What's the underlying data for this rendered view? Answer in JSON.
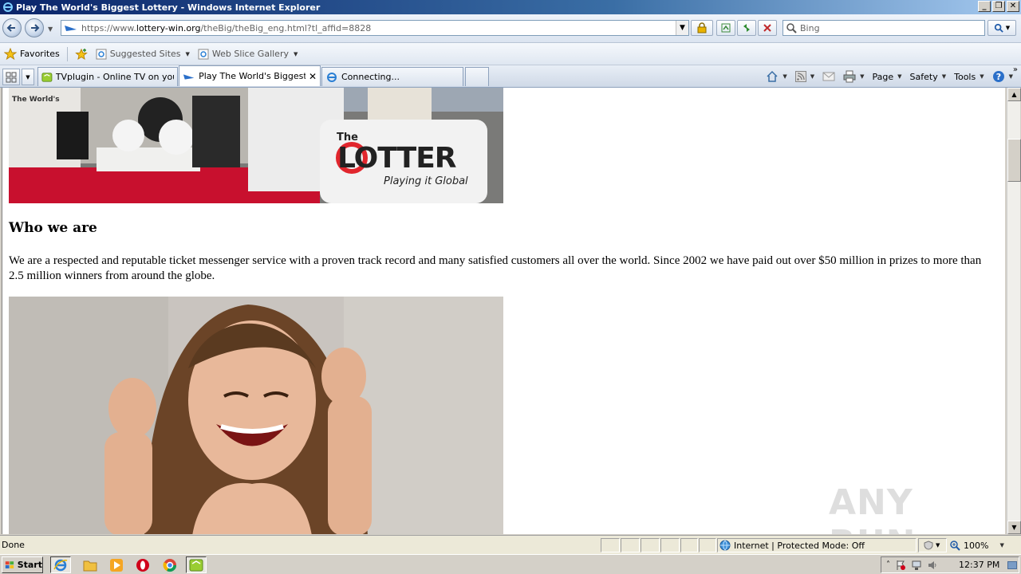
{
  "window": {
    "title": "Play The World's Biggest Lottery - Windows Internet Explorer"
  },
  "address": {
    "url_prefix": "https://www.",
    "url_domain": "lottery-win.org",
    "url_path": "/theBig/theBig_eng.html?tl_affid=8828"
  },
  "search": {
    "placeholder": "Bing"
  },
  "favorites_bar": {
    "favorites_label": "Favorites",
    "suggested_sites_label": "Suggested Sites",
    "web_slice_label": "Web Slice Gallery"
  },
  "tabs": [
    {
      "label": "TVplugin - Online TV on your ..."
    },
    {
      "label": "Play The World's Biggest ..."
    },
    {
      "label": "Connecting..."
    }
  ],
  "command_bar": {
    "page_label": "Page",
    "safety_label": "Safety",
    "tools_label": "Tools"
  },
  "page": {
    "banner_logo_the": "The",
    "banner_logo_main": "LOTTER",
    "banner_logo_tagline": "Playing it Global",
    "heading": "Who we are",
    "paragraph": "We are a respected and reputable ticket messenger service with a proven track record and many satisfied customers all over the world. Since 2002 we have paid out over $50 million in prizes to more than 2.5 million winners from around the globe.",
    "watermark": "ANY RUN"
  },
  "status_bar": {
    "status": "Done",
    "zone": "Internet | Protected Mode: Off",
    "zoom": "100%"
  },
  "taskbar": {
    "start_label": "Start",
    "clock": "12:37 PM"
  },
  "colors": {
    "titlebar": "#0a246a",
    "lotter_red": "#e1262d",
    "carpet_red": "#c8102e"
  }
}
